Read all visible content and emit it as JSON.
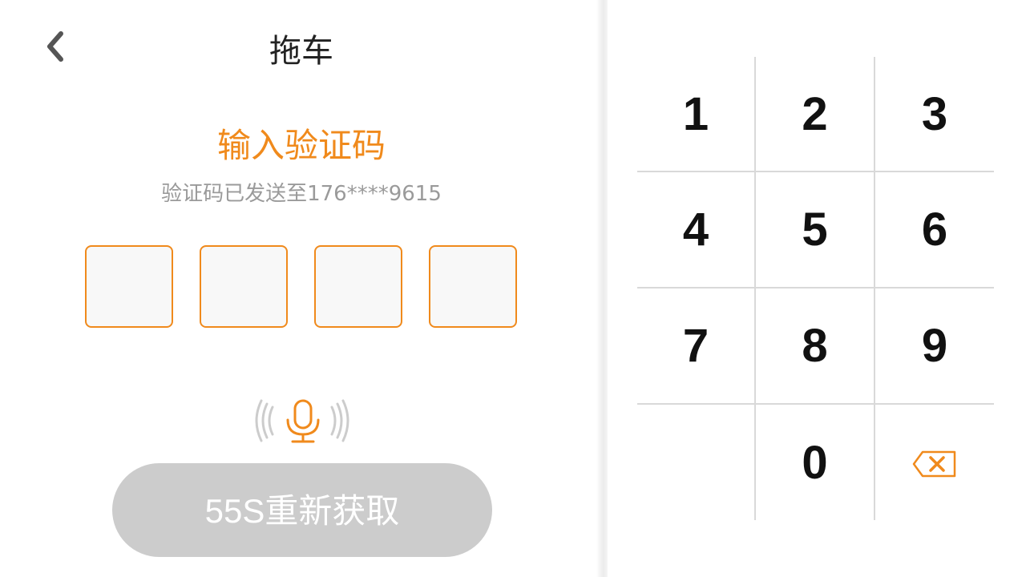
{
  "header": {
    "title": "拖车",
    "back_icon": "chevron-left-icon"
  },
  "verification": {
    "heading": "输入验证码",
    "sent_message": "验证码已发送至176****9615",
    "code_digits": [
      "",
      "",
      "",
      ""
    ],
    "voice_icon": "microphone-icon",
    "resend_label": "55S重新获取"
  },
  "keypad": {
    "keys": [
      {
        "label": "1"
      },
      {
        "label": "2"
      },
      {
        "label": "3"
      },
      {
        "label": "4"
      },
      {
        "label": "5"
      },
      {
        "label": "6"
      },
      {
        "label": "7"
      },
      {
        "label": "8"
      },
      {
        "label": "9"
      },
      {
        "label": ""
      },
      {
        "label": "0"
      },
      {
        "icon": "backspace-icon"
      }
    ]
  },
  "colors": {
    "accent": "#f08a1c",
    "disabled_button": "#cccccc",
    "muted_text": "#9a9a9a",
    "divider": "#d9d9d9"
  }
}
